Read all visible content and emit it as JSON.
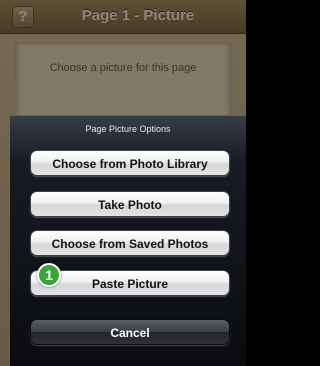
{
  "navbar": {
    "help_label": "?",
    "title": "Page 1 - Picture"
  },
  "page": {
    "hint": "Choose a picture for this page"
  },
  "action_sheet": {
    "title": "Page Picture Options",
    "buttons": [
      {
        "label": "Choose from Photo Library"
      },
      {
        "label": "Take Photo"
      },
      {
        "label": "Choose from Saved Photos"
      },
      {
        "label": "Paste Picture"
      }
    ],
    "cancel_label": "Cancel",
    "step_badge": "1"
  },
  "colors": {
    "navbar": "#8f7850",
    "badge": "#3aa33a",
    "sheet": "#0e1116"
  }
}
